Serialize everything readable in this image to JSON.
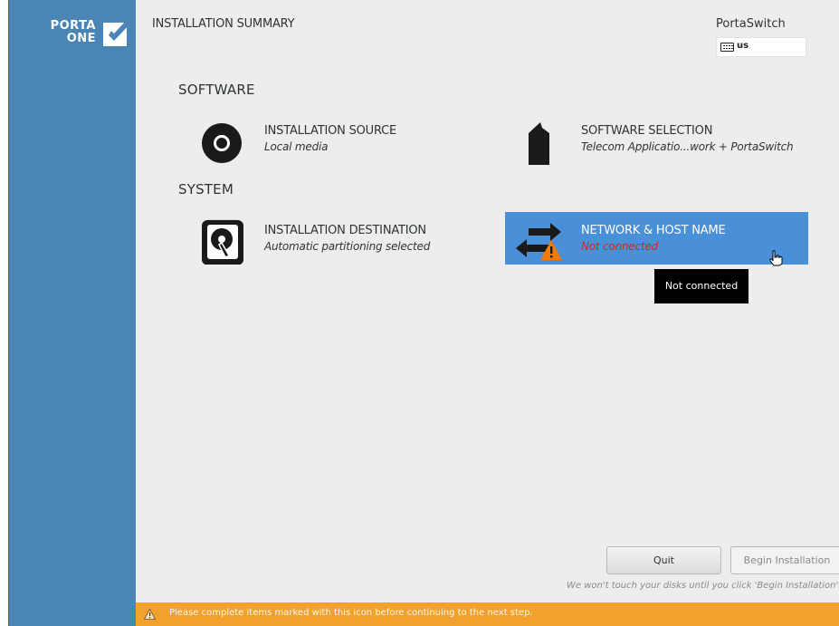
{
  "brand": {
    "logo_line1": "PORTA",
    "logo_line2": "ONE"
  },
  "header": {
    "title": "INSTALLATION SUMMARY",
    "product": "PortaSwitch",
    "keyboard_layout": "us"
  },
  "sections": {
    "software": "SOFTWARE",
    "system": "SYSTEM"
  },
  "spokes": {
    "installation_source": {
      "title": "INSTALLATION SOURCE",
      "status": "Local media",
      "icon": "disc-icon"
    },
    "software_selection": {
      "title": "SOFTWARE SELECTION",
      "status": "Telecom Applicatio...work + PortaSwitch",
      "icon": "package-icon"
    },
    "installation_destination": {
      "title": "INSTALLATION DESTINATION",
      "status": "Automatic partitioning selected",
      "icon": "harddisk-icon"
    },
    "network_host": {
      "title": "NETWORK & HOST NAME",
      "status": "Not connected",
      "icon": "network-arrows-icon",
      "warning": "warning-icon"
    }
  },
  "tooltip": "Not connected",
  "buttons": {
    "quit": "Quit",
    "begin": "Begin Installation"
  },
  "note": "We won't touch your disks until you click 'Begin Installation'.",
  "warning_bar": "Please complete items marked with this icon before continuing to the next step.",
  "colors": {
    "sidebar": "#4a85b5",
    "selected_spoke": "#4a90d9",
    "warning_bar": "#f0a12e",
    "error_text": "#d0281a"
  }
}
